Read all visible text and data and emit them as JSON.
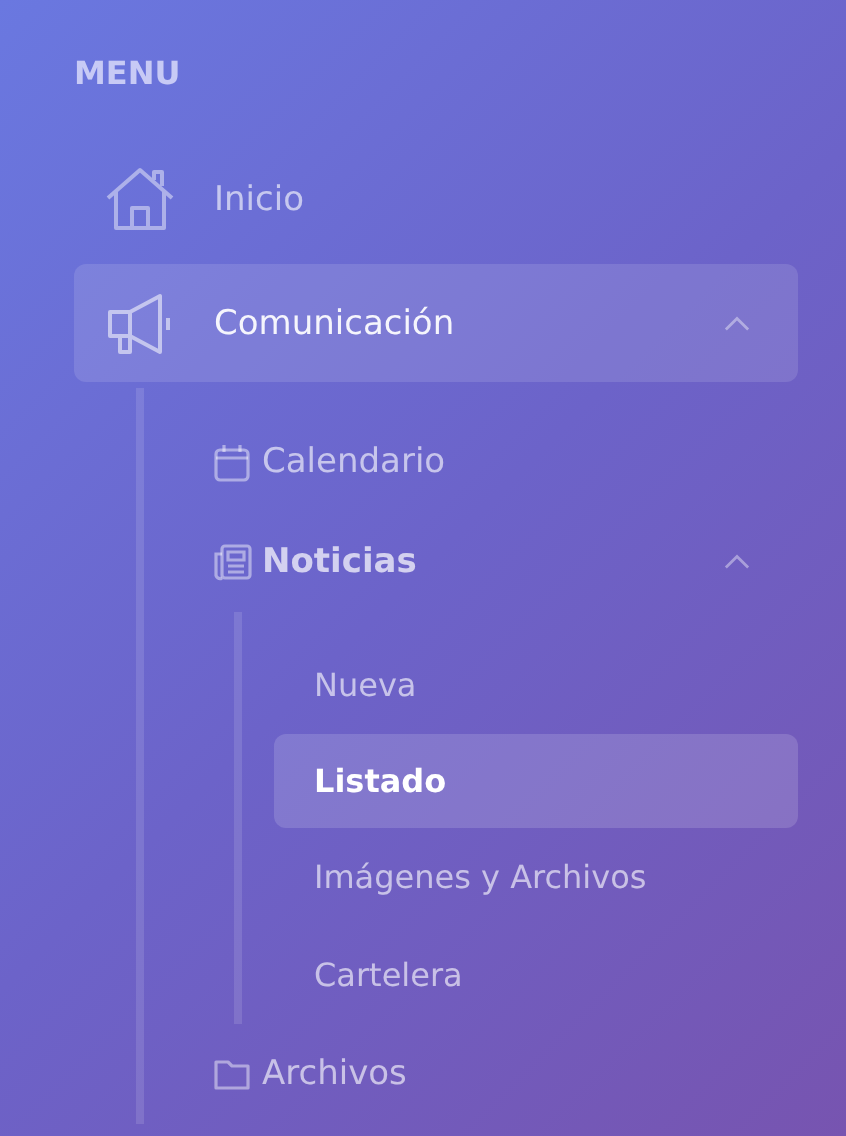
{
  "menu_title": "MENU",
  "items": [
    {
      "label": "Inicio",
      "kind": "home",
      "selected": false
    },
    {
      "label": "Comunicación",
      "kind": "megaphone",
      "selected": false,
      "expanded": true,
      "children": [
        {
          "label": "Calendario",
          "kind": "calendar",
          "selected": false
        },
        {
          "label": "Noticias",
          "kind": "newspaper",
          "selected": false,
          "expanded": true,
          "children": [
            {
              "label": "Nueva",
              "selected": false
            },
            {
              "label": "Listado",
              "selected": true
            },
            {
              "label": "Imágenes y Archivos",
              "selected": false
            },
            {
              "label": "Cartelera",
              "selected": false
            }
          ]
        },
        {
          "label": "Archivos",
          "kind": "folder",
          "selected": false
        }
      ]
    }
  ]
}
